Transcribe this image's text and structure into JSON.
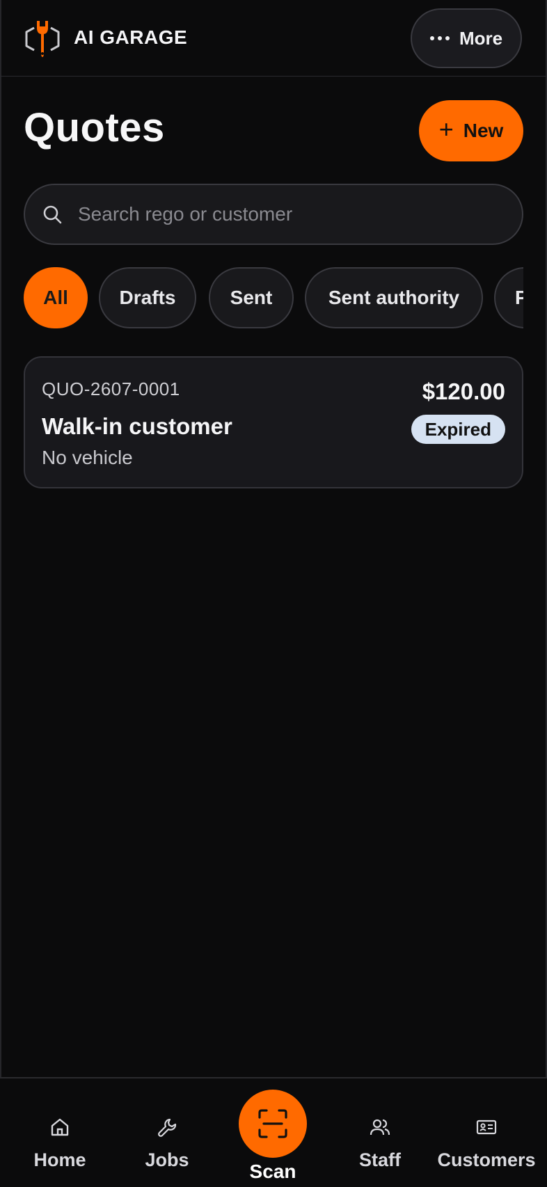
{
  "header": {
    "brand": "AI GARAGE",
    "more_label": "More"
  },
  "page": {
    "title": "Quotes",
    "new_label": "New"
  },
  "search": {
    "placeholder": "Search rego or customer",
    "value": ""
  },
  "filters": [
    {
      "label": "All",
      "active": true
    },
    {
      "label": "Drafts",
      "active": false
    },
    {
      "label": "Sent",
      "active": false
    },
    {
      "label": "Sent authority",
      "active": false
    },
    {
      "label": "P",
      "active": false
    }
  ],
  "quotes": [
    {
      "number": "QUO-2607-0001",
      "customer": "Walk-in customer",
      "vehicle": "No vehicle",
      "amount": "$120.00",
      "status": "Expired"
    }
  ],
  "bottom_nav": {
    "home": "Home",
    "jobs": "Jobs",
    "scan": "Scan",
    "staff": "Staff",
    "customers": "Customers"
  },
  "colors": {
    "accent": "#ff6a00",
    "background": "#0b0b0c",
    "card": "#18181c",
    "badge_expired": "#d6e2f2"
  },
  "icons": {
    "logo": "wrench-hexagon-logo",
    "more": "more-dots-icon",
    "search": "search-icon",
    "new": "plus-icon",
    "home": "home-icon",
    "jobs": "wrench-icon",
    "scan": "scan-icon",
    "staff": "users-icon",
    "customers": "id-card-icon"
  }
}
